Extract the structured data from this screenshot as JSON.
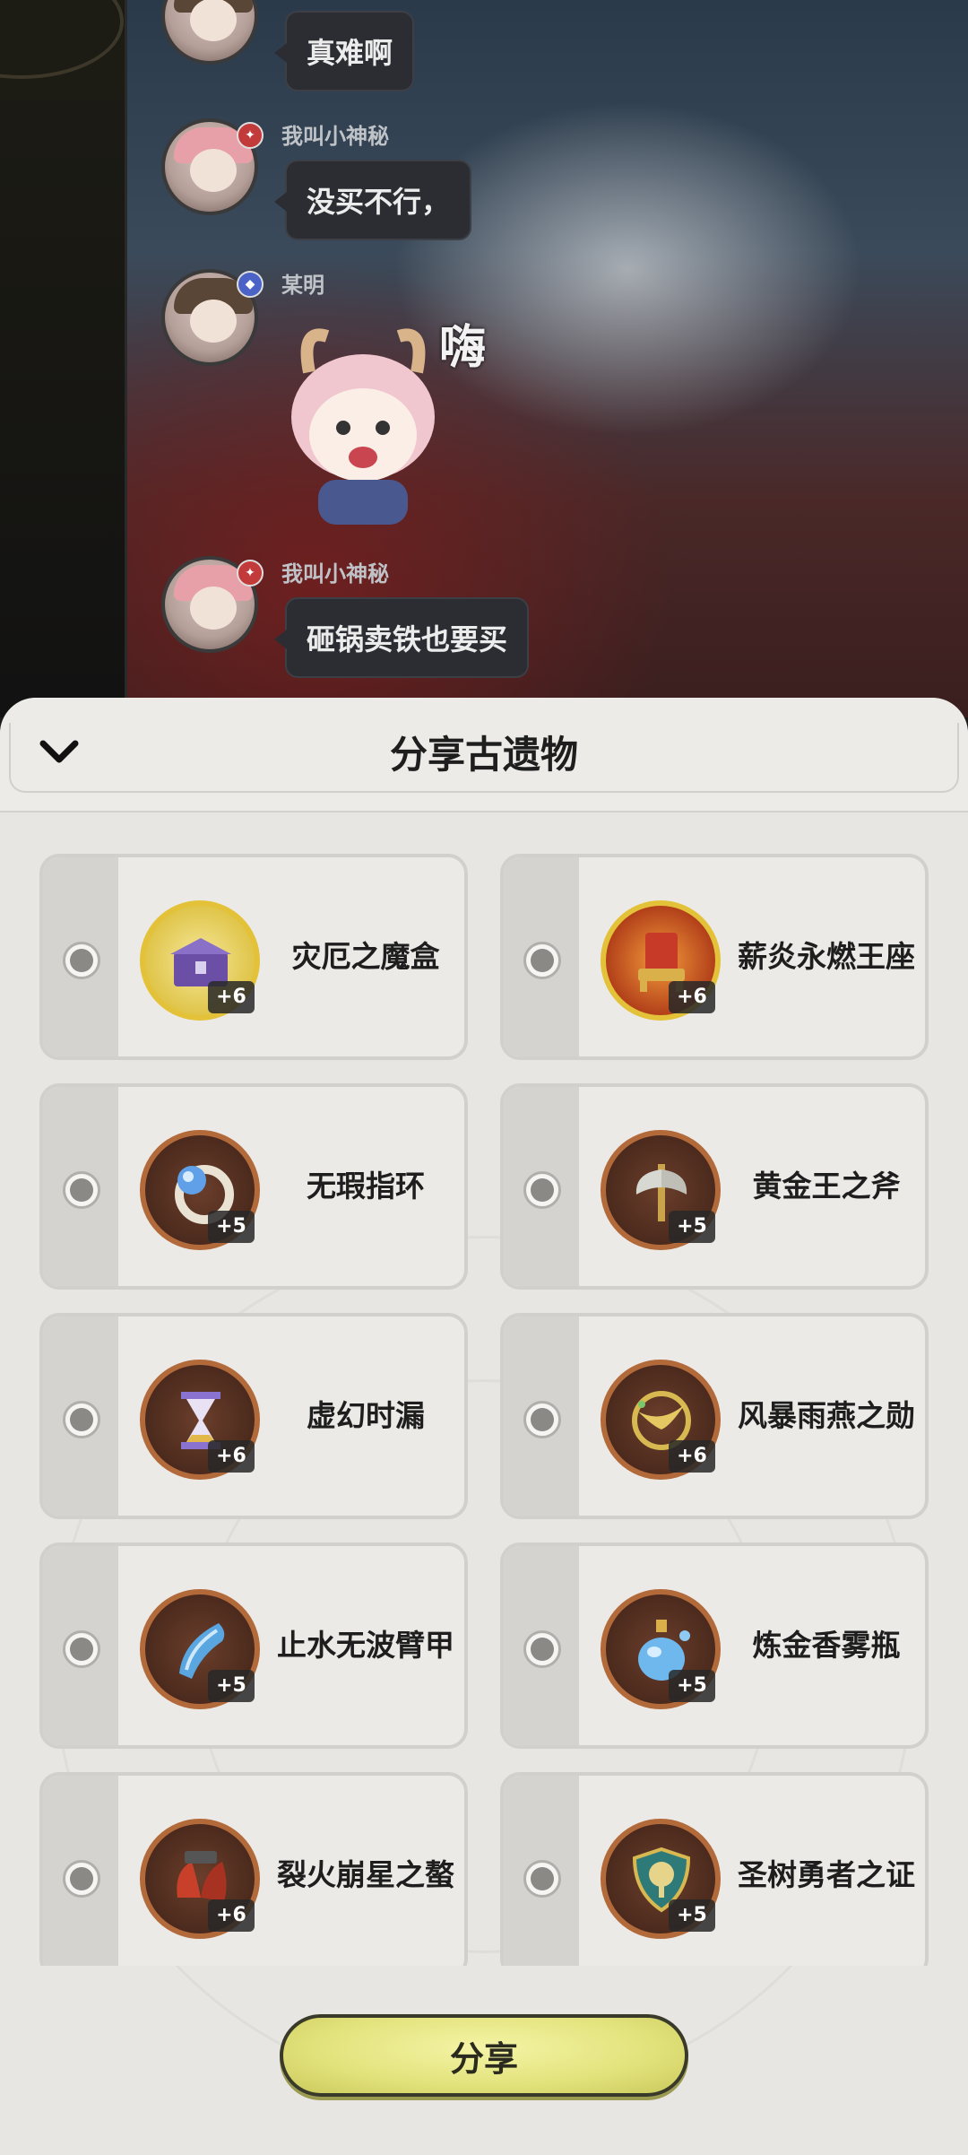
{
  "chat": {
    "messages": [
      {
        "username": "",
        "text": "真难啊"
      },
      {
        "username": "我叫小神秘",
        "text": "没买不行，"
      },
      {
        "username": "某明",
        "sticker_text": "嗨"
      },
      {
        "username": "我叫小神秘",
        "text": "砸锅卖铁也要买"
      }
    ]
  },
  "sheet": {
    "title": "分享古遗物",
    "collapse_icon": "chevron-down-icon"
  },
  "relics": [
    {
      "name": "灾厄之魔盒",
      "level": "+6",
      "frame": "gold",
      "icon": "box-icon"
    },
    {
      "name": "薪炎永燃王座",
      "level": "+6",
      "frame": "gold",
      "icon": "throne-icon"
    },
    {
      "name": "无瑕指环",
      "level": "+5",
      "frame": "bronze",
      "icon": "ring-icon"
    },
    {
      "name": "黄金王之斧",
      "level": "+5",
      "frame": "bronze",
      "icon": "axe-icon"
    },
    {
      "name": "虚幻时漏",
      "level": "+6",
      "frame": "bronze",
      "icon": "hourglass-icon"
    },
    {
      "name": "风暴雨燕之勋",
      "level": "+6",
      "frame": "bronze",
      "icon": "medal-icon"
    },
    {
      "name": "止水无波臂甲",
      "level": "+5",
      "frame": "bronze",
      "icon": "bracer-icon"
    },
    {
      "name": "炼金香雾瓶",
      "level": "+5",
      "frame": "bronze",
      "icon": "perfume-icon"
    },
    {
      "name": "裂火崩星之螯",
      "level": "+6",
      "frame": "bronze",
      "icon": "claw-icon"
    },
    {
      "name": "圣树勇者之证",
      "level": "+5",
      "frame": "bronze",
      "icon": "shield-icon"
    }
  ],
  "share_button": {
    "label": "分享"
  },
  "colors": {
    "gold_frame": "#e3c23a",
    "bronze_frame": "#b26a3a",
    "share_button": "#e2e27b"
  }
}
